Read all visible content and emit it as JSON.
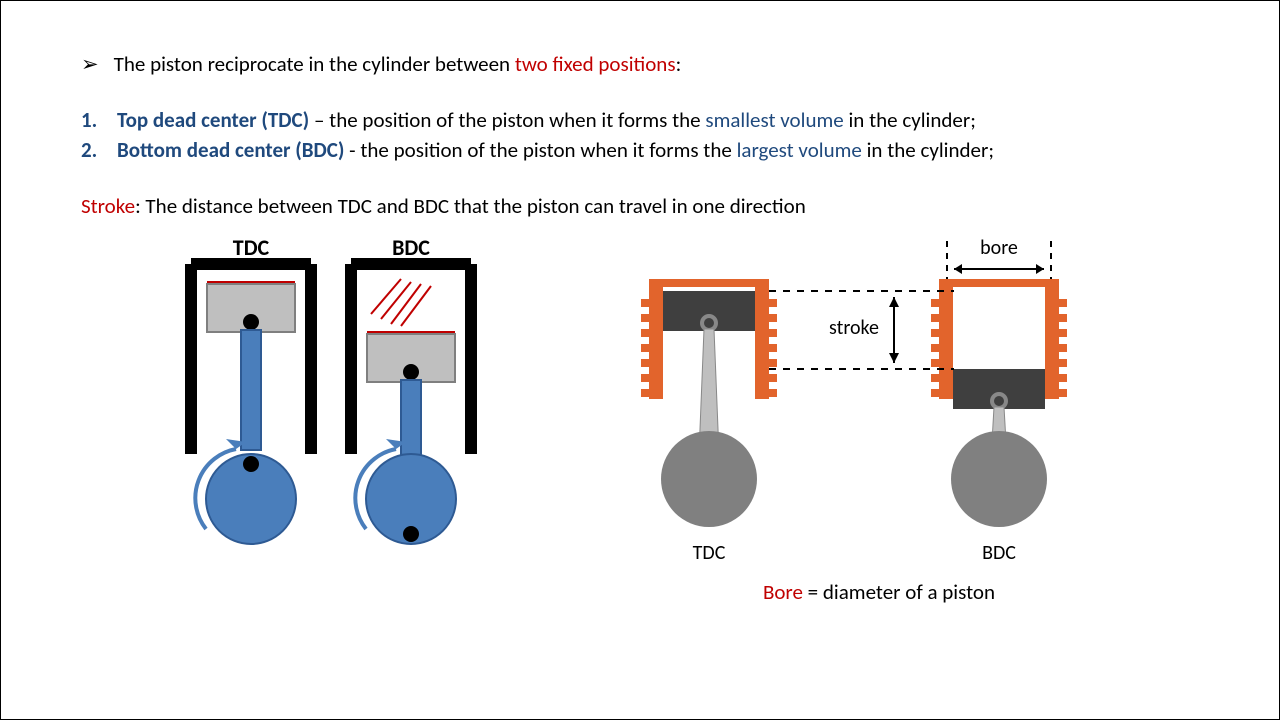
{
  "bullet": {
    "prefix": "The piston reciprocate in the cylinder between ",
    "highlight": "two fixed positions",
    "suffix": ":"
  },
  "items": [
    {
      "num": "1.",
      "term": "Top dead center (TDC)",
      "sep": " – the position of the piston when it forms the ",
      "highlight": "smallest volume",
      "tail": " in the cylinder;"
    },
    {
      "num": "2.",
      "term": "Bottom dead center (BDC)",
      "sep": " -  the position of the piston when it forms the ",
      "highlight": "largest volume",
      "tail": " in the cylinder;"
    }
  ],
  "stroke": {
    "label": "Stroke",
    "text": ": The distance between TDC and BDC that the piston can travel in one direction"
  },
  "labels": {
    "tdc": "TDC",
    "bdc": "BDC",
    "stroke": "stroke",
    "bore": "bore"
  },
  "bore_def": {
    "label": "Bore",
    "text": " =  diameter of a piston"
  }
}
